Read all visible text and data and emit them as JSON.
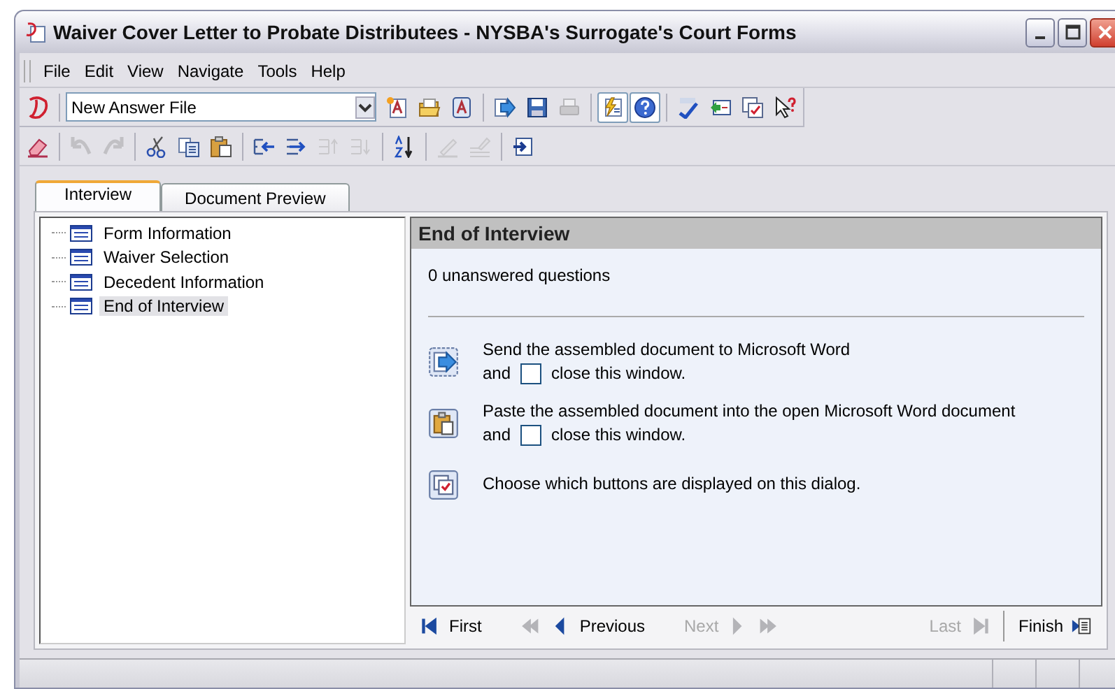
{
  "window": {
    "title": "Waiver Cover Letter to Probate Distributees - NYSBA's Surrogate's Court Forms"
  },
  "menu": [
    "File",
    "Edit",
    "View",
    "Navigate",
    "Tools",
    "Help"
  ],
  "answer_file": {
    "value": "New Answer File"
  },
  "toolbar_1": [
    {
      "kind": "button",
      "disabled": false,
      "pressed": false
    },
    {
      "kind": "button",
      "disabled": false,
      "pressed": false
    },
    {
      "kind": "button",
      "disabled": false,
      "pressed": false
    },
    {
      "kind": "separator"
    },
    {
      "kind": "button",
      "disabled": false,
      "pressed": false
    },
    {
      "kind": "button",
      "disabled": false,
      "pressed": false
    },
    {
      "kind": "button",
      "disabled": true,
      "pressed": false
    },
    {
      "kind": "separator"
    },
    {
      "kind": "button",
      "disabled": false,
      "pressed": true
    },
    {
      "kind": "button",
      "disabled": false,
      "pressed": true
    },
    {
      "kind": "separator"
    },
    {
      "kind": "button",
      "disabled": false,
      "pressed": false
    },
    {
      "kind": "button",
      "disabled": false,
      "pressed": false
    },
    {
      "kind": "button",
      "disabled": false,
      "pressed": false
    },
    {
      "kind": "button",
      "disabled": false,
      "pressed": false
    }
  ],
  "toolbar_2": [
    {
      "kind": "button",
      "disabled": false
    },
    {
      "kind": "separator"
    },
    {
      "kind": "button",
      "disabled": true
    },
    {
      "kind": "button",
      "disabled": true
    },
    {
      "kind": "separator"
    },
    {
      "kind": "button",
      "disabled": false
    },
    {
      "kind": "button",
      "disabled": false
    },
    {
      "kind": "button",
      "disabled": false
    },
    {
      "kind": "separator"
    },
    {
      "kind": "button",
      "disabled": false
    },
    {
      "kind": "button",
      "disabled": false
    },
    {
      "kind": "button",
      "disabled": true
    },
    {
      "kind": "button",
      "disabled": true
    },
    {
      "kind": "separator"
    },
    {
      "kind": "button",
      "disabled": false
    },
    {
      "kind": "separator"
    },
    {
      "kind": "button",
      "disabled": true
    },
    {
      "kind": "button",
      "disabled": true
    },
    {
      "kind": "separator"
    },
    {
      "kind": "button",
      "disabled": false
    }
  ],
  "tabs": [
    {
      "label": "Interview",
      "selected": true
    },
    {
      "label": "Document Preview",
      "selected": false
    }
  ],
  "outline": [
    {
      "label": "Form Information",
      "selected": false
    },
    {
      "label": "Waiver Selection",
      "selected": false
    },
    {
      "label": "Decedent Information",
      "selected": false
    },
    {
      "label": "End of Interview",
      "selected": true
    }
  ],
  "panel": {
    "title": "End of Interview",
    "summary": "0 unanswered questions",
    "actions": [
      {
        "kind": "send",
        "text": "Send the assembled document to Microsoft Word",
        "and": "and",
        "close_text": "close this window.",
        "checked": false
      },
      {
        "kind": "paste",
        "text": "Paste the assembled document into the open Microsoft Word document",
        "and": "and",
        "close_text": "close this window.",
        "checked": false
      },
      {
        "kind": "choose",
        "text": "Choose which buttons are displayed on this dialog."
      }
    ]
  },
  "navigation": [
    {
      "kind": "first",
      "label": "First",
      "disabled": false
    },
    {
      "kind": "rewind",
      "disabled": true
    },
    {
      "kind": "previous",
      "label": "Previous",
      "disabled": false
    },
    {
      "kind": "next",
      "label": "Next",
      "disabled": true
    },
    {
      "kind": "forward",
      "disabled": true
    },
    {
      "kind": "last",
      "label": "Last",
      "disabled": true
    },
    {
      "kind": "finish",
      "label": "Finish",
      "disabled": false
    }
  ]
}
